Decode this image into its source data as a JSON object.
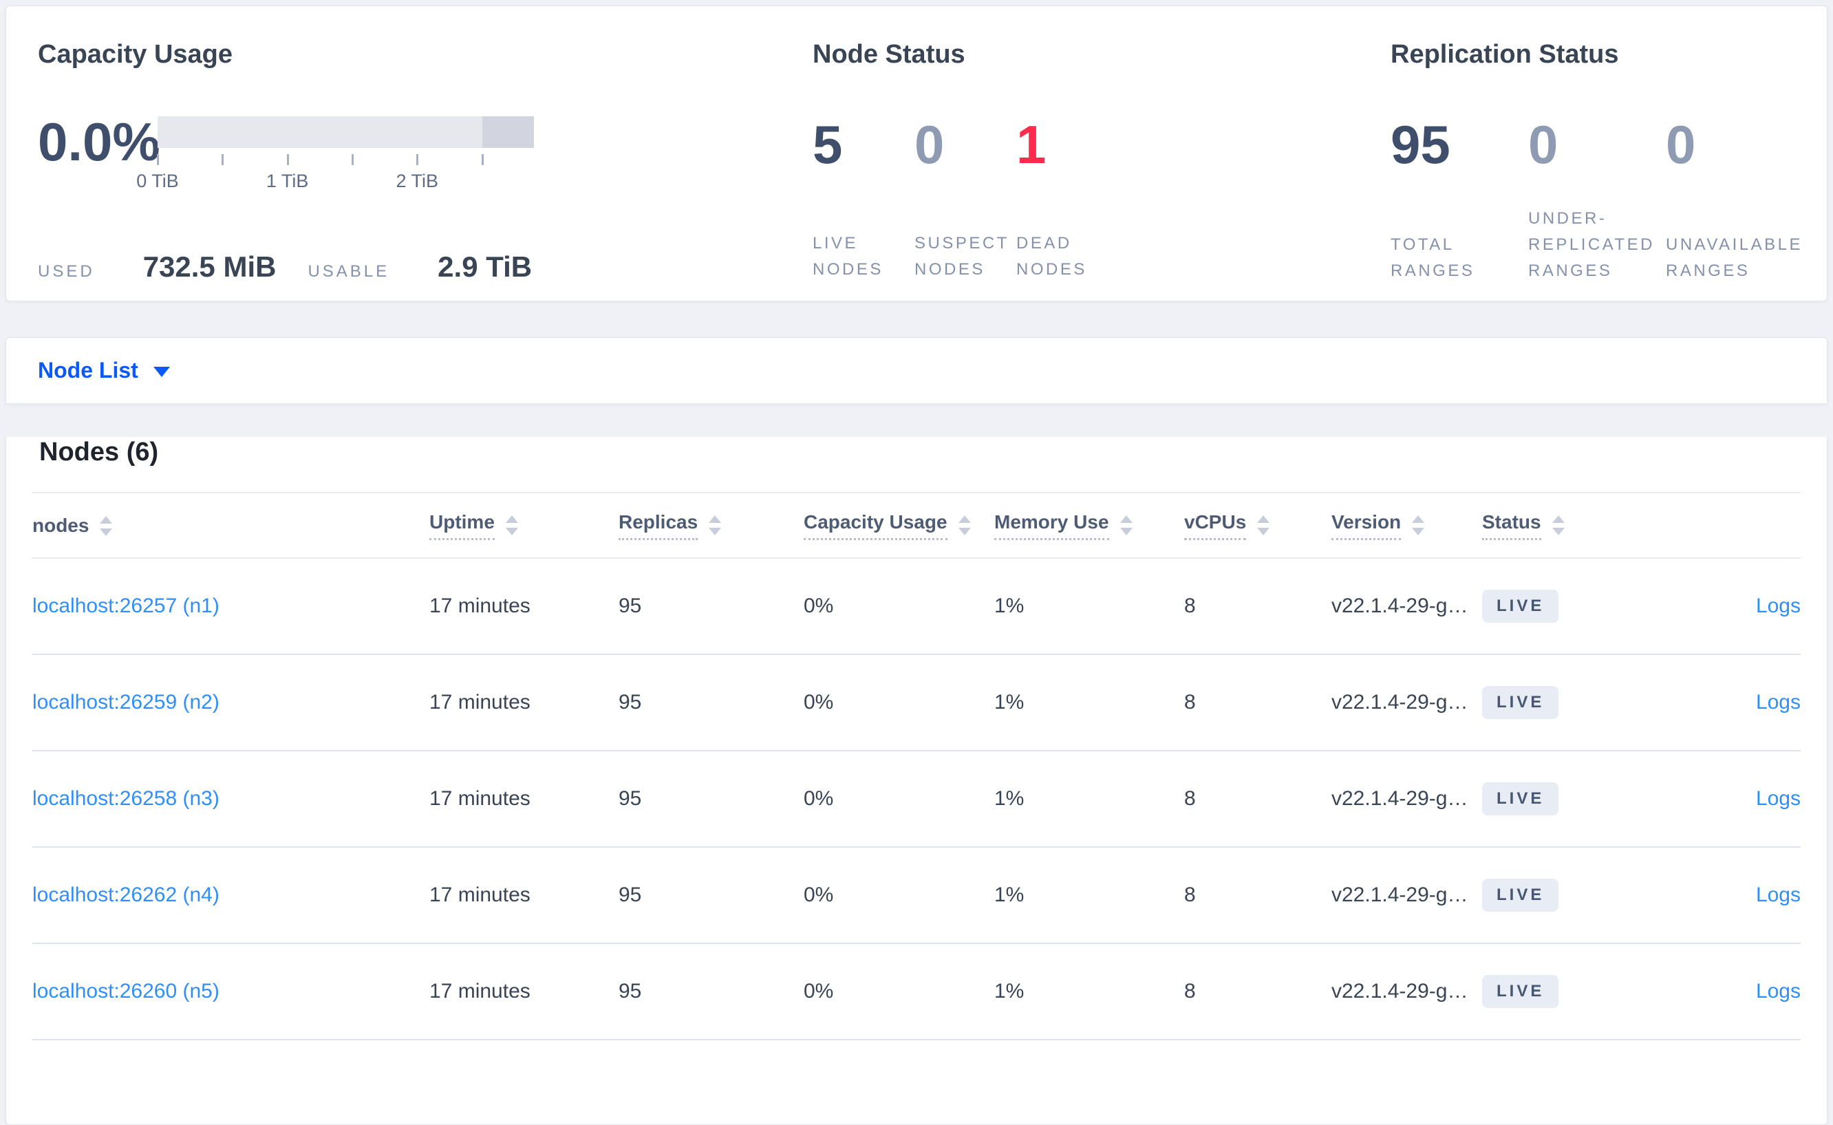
{
  "summary": {
    "capacity": {
      "title": "Capacity Usage",
      "percent": "0.0%",
      "used_label": "USED",
      "used_value": "732.5 MiB",
      "usable_label": "USABLE",
      "usable_value": "2.9 TiB",
      "axis_tick_labels": [
        "0 TiB",
        "1 TiB",
        "2 TiB"
      ],
      "bar": {
        "total_tib": 2.9,
        "used_fraction": 0.0,
        "tick_interval_tib": 0.5,
        "track_color": "#e7e8ee",
        "end_segment_color": "#d2d5df"
      }
    },
    "node_status": {
      "title": "Node Status",
      "stats": [
        {
          "value": "5",
          "label": "LIVE NODES"
        },
        {
          "value": "0",
          "label": "SUSPECT NODES"
        },
        {
          "value": "1",
          "label": "DEAD NODES"
        }
      ]
    },
    "replication_status": {
      "title": "Replication Status",
      "stats": [
        {
          "value": "95",
          "label": "TOTAL RANGES"
        },
        {
          "value": "0",
          "label": "UNDER-REPLICATED RANGES"
        },
        {
          "value": "0",
          "label": "UNAVAILABLE RANGES"
        }
      ]
    }
  },
  "view_selector": {
    "label": "Node List"
  },
  "nodes_section": {
    "title": "Nodes (6)",
    "columns": [
      {
        "label": "nodes"
      },
      {
        "label": "Uptime"
      },
      {
        "label": "Replicas"
      },
      {
        "label": "Capacity Usage"
      },
      {
        "label": "Memory Use"
      },
      {
        "label": "vCPUs"
      },
      {
        "label": "Version"
      },
      {
        "label": "Status"
      },
      {
        "label": ""
      }
    ],
    "rows": [
      {
        "node": "localhost:26257 (n1)",
        "uptime": "17 minutes",
        "replicas": "95",
        "capacity_usage": "0%",
        "memory_use": "1%",
        "vcpus": "8",
        "version": "v22.1.4-29-g…",
        "status": "LIVE",
        "logs_label": "Logs"
      },
      {
        "node": "localhost:26259 (n2)",
        "uptime": "17 minutes",
        "replicas": "95",
        "capacity_usage": "0%",
        "memory_use": "1%",
        "vcpus": "8",
        "version": "v22.1.4-29-g…",
        "status": "LIVE",
        "logs_label": "Logs"
      },
      {
        "node": "localhost:26258 (n3)",
        "uptime": "17 minutes",
        "replicas": "95",
        "capacity_usage": "0%",
        "memory_use": "1%",
        "vcpus": "8",
        "version": "v22.1.4-29-g…",
        "status": "LIVE",
        "logs_label": "Logs"
      },
      {
        "node": "localhost:26262 (n4)",
        "uptime": "17 minutes",
        "replicas": "95",
        "capacity_usage": "0%",
        "memory_use": "1%",
        "vcpus": "8",
        "version": "v22.1.4-29-g…",
        "status": "LIVE",
        "logs_label": "Logs"
      },
      {
        "node": "localhost:26260 (n5)",
        "uptime": "17 minutes",
        "replicas": "95",
        "capacity_usage": "0%",
        "memory_use": "1%",
        "vcpus": "8",
        "version": "v22.1.4-29-g…",
        "status": "LIVE",
        "logs_label": "Logs"
      }
    ]
  },
  "colors": {
    "accent_blue": "#0b5af5",
    "link_blue": "#2e8ff8",
    "danger_red": "#ff2b4d",
    "muted_number": "#8f9ab3",
    "dark_number": "#3f4e6a",
    "badge_bg": "#e8ecf4"
  }
}
